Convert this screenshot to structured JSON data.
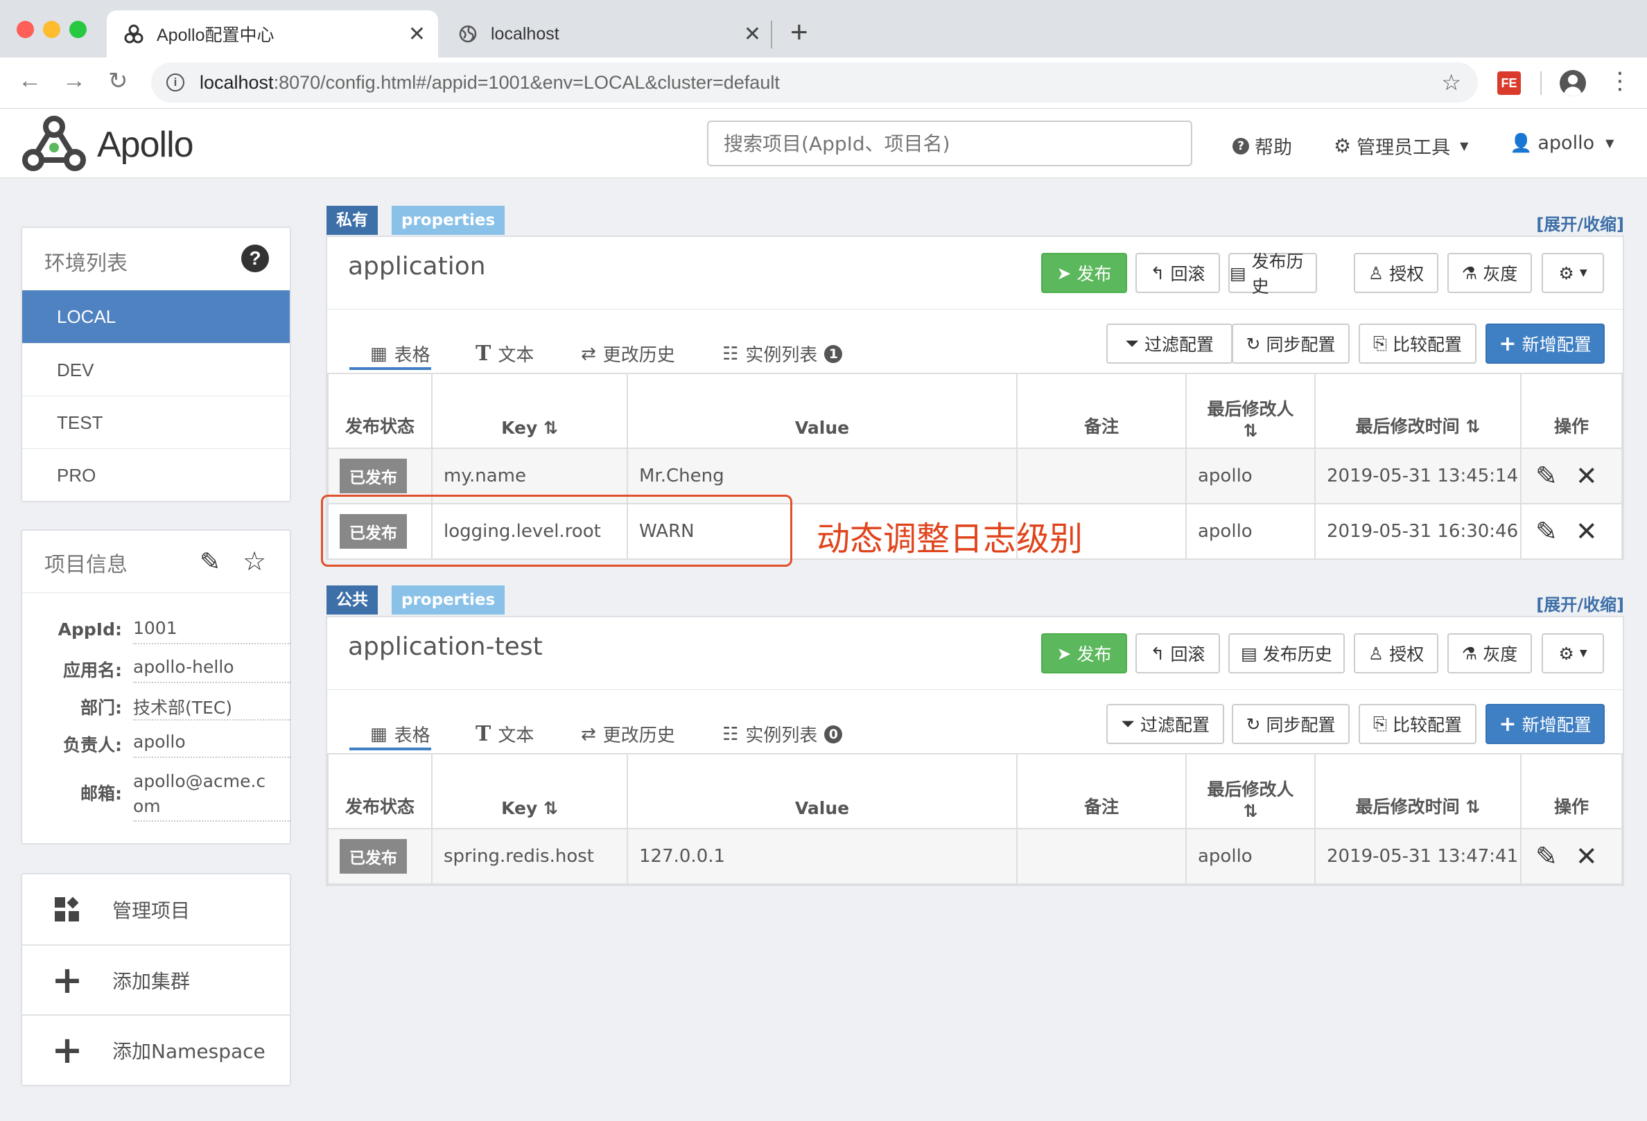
{
  "browser": {
    "tabs": [
      {
        "title": "Apollo配置中心",
        "active": true
      },
      {
        "title": "localhost",
        "active": false
      }
    ],
    "url_host": "localhost",
    "url_rest": ":8070/config.html#/appid=1001&env=LOCAL&cluster=default",
    "traffic_colors": [
      "#fe5f57",
      "#febc2e",
      "#28c840"
    ]
  },
  "header": {
    "logo": "Apollo",
    "search_placeholder": "搜索项目(AppId、项目名)",
    "help": "帮助",
    "admin_tools": "管理员工具",
    "user": "apollo"
  },
  "env_panel": {
    "title": "环境列表",
    "items": [
      "LOCAL",
      "DEV",
      "TEST",
      "PRO"
    ],
    "active": "LOCAL"
  },
  "project_info": {
    "title": "项目信息",
    "rows": [
      {
        "label": "AppId:",
        "value": "1001"
      },
      {
        "label": "应用名:",
        "value": "apollo-hello"
      },
      {
        "label": "部门:",
        "value": "技术部(TEC)"
      },
      {
        "label": "负责人:",
        "value": "apollo"
      },
      {
        "label": "邮箱:",
        "value_line1": "apollo@acme.c",
        "value_line2": "om"
      }
    ]
  },
  "actions": [
    "管理项目",
    "添加集群",
    "添加Namespace"
  ],
  "common": {
    "expand": "[展开/收缩]",
    "format": "properties",
    "buttons": {
      "publish": "发布",
      "rollback": "回滚",
      "history": "发布历史",
      "grant": "授权",
      "gray": "灰度"
    },
    "toolbar": {
      "filter": "过滤配置",
      "sync": "同步配置",
      "compare": "比较配置",
      "add": "新增配置"
    },
    "subtabs": {
      "table": "表格",
      "text": "文本",
      "history": "更改历史",
      "instances": "实例列表"
    },
    "columns": {
      "status": "发布状态",
      "key": "Key",
      "value": "Value",
      "comment": "备注",
      "modifier": "最后修改人",
      "modified_time": "最后修改时间",
      "ops": "操作"
    }
  },
  "namespaces": [
    {
      "scope": "私有",
      "name": "application",
      "instance_count": "1",
      "rows": [
        {
          "status": "已发布",
          "key": "my.name",
          "value": "Mr.Cheng",
          "comment": "",
          "modifier": "apollo",
          "time": "2019-05-31 13:45:14"
        },
        {
          "status": "已发布",
          "key": "logging.level.root",
          "value": "WARN",
          "comment": "",
          "modifier": "apollo",
          "time": "2019-05-31 16:30:46"
        }
      ]
    },
    {
      "scope": "公共",
      "name": "application-test",
      "instance_count": "0",
      "rows": [
        {
          "status": "已发布",
          "key": "spring.redis.host",
          "value": "127.0.0.1",
          "comment": "",
          "modifier": "apollo",
          "time": "2019-05-31 13:47:41"
        }
      ]
    }
  ],
  "annotation": "动态调整日志级别"
}
